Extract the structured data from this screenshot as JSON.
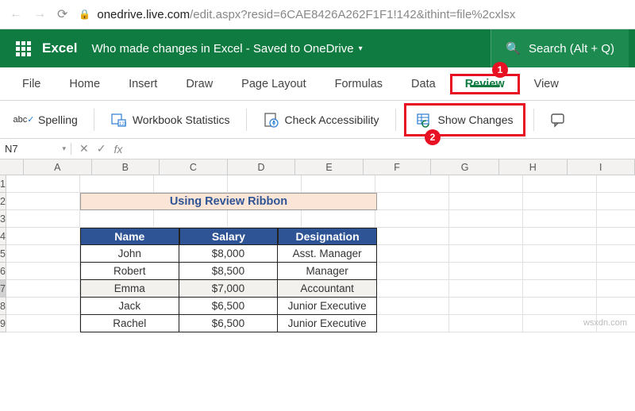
{
  "browser": {
    "url_domain": "onedrive.live.com",
    "url_path": "/edit.aspx?resid=6CAE8426A262F1F1!142&ithint=file%2cxlsx"
  },
  "title": {
    "app": "Excel",
    "doc": "Who made changes in Excel - Saved to OneDrive",
    "search": "Search (Alt + Q)"
  },
  "tabs": {
    "file": "File",
    "home": "Home",
    "insert": "Insert",
    "draw": "Draw",
    "page_layout": "Page Layout",
    "formulas": "Formulas",
    "data": "Data",
    "review": "Review",
    "view": "View"
  },
  "cmds": {
    "spelling": "Spelling",
    "workbook_stats": "Workbook Statistics",
    "check_access": "Check Accessibility",
    "show_changes": "Show Changes"
  },
  "callouts": {
    "one": "1",
    "two": "2"
  },
  "namebox": "N7",
  "fx": "fx",
  "columns": [
    "A",
    "B",
    "C",
    "D",
    "E",
    "F",
    "G",
    "H",
    "I"
  ],
  "rows": [
    "1",
    "2",
    "3",
    "4",
    "5",
    "6",
    "7",
    "8",
    "9"
  ],
  "selected_row": "7",
  "sheet": {
    "title": "Using Review Ribbon",
    "headers": {
      "name": "Name",
      "salary": "Salary",
      "designation": "Designation"
    },
    "data": [
      {
        "name": "John",
        "salary": "$8,000",
        "designation": "Asst. Manager"
      },
      {
        "name": "Robert",
        "salary": "$8,500",
        "designation": "Manager"
      },
      {
        "name": "Emma",
        "salary": "$7,000",
        "designation": "Accountant"
      },
      {
        "name": "Jack",
        "salary": "$6,500",
        "designation": "Junior Executive"
      },
      {
        "name": "Rachel",
        "salary": "$6,500",
        "designation": "Junior Executive"
      }
    ]
  },
  "watermark": "wsxdn.com"
}
